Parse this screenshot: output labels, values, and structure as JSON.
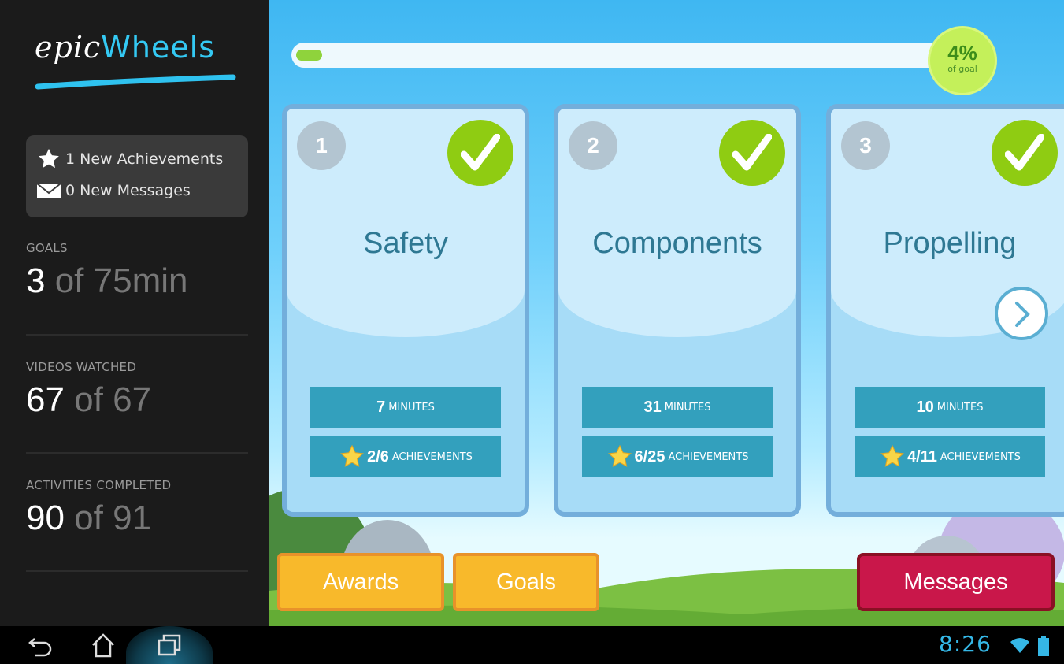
{
  "app": {
    "logo_part1": "epic",
    "logo_part2": "Wheels"
  },
  "notifications": {
    "achievements": "1 New Achievements",
    "messages": "0 New Messages"
  },
  "stats": [
    {
      "label": "GOALS",
      "num": "3",
      "rest": " of 75min"
    },
    {
      "label": "VIDEOS WATCHED",
      "num": "67",
      "rest": " of 67"
    },
    {
      "label": "ACTIVITIES COMPLETED",
      "num": "90",
      "rest": " of 91"
    }
  ],
  "progress": {
    "value_fraction": 0.04,
    "percent_label": "4%",
    "sub_label": "of goal"
  },
  "modules": [
    {
      "number": "1",
      "title": "Safety",
      "minutes": "7",
      "minutes_label": "MINUTES",
      "achievements": "2/6",
      "achievements_label": "ACHIEVEMENTS",
      "completed": true
    },
    {
      "number": "2",
      "title": "Components",
      "minutes": "31",
      "minutes_label": "MINUTES",
      "achievements": "6/25",
      "achievements_label": "ACHIEVEMENTS",
      "completed": true
    },
    {
      "number": "3",
      "title": "Propelling",
      "minutes": "10",
      "minutes_label": "MINUTES",
      "achievements": "4/11",
      "achievements_label": "ACHIEVEMENTS",
      "completed": true
    }
  ],
  "buttons": {
    "awards": "Awards",
    "goals": "Goals",
    "messages": "Messages"
  },
  "system": {
    "time": "8:26"
  },
  "colors": {
    "accent_blue": "#34c9f3",
    "check_green": "#8fcc12",
    "button_yellow": "#f8b92b",
    "button_red": "#c9174a"
  }
}
